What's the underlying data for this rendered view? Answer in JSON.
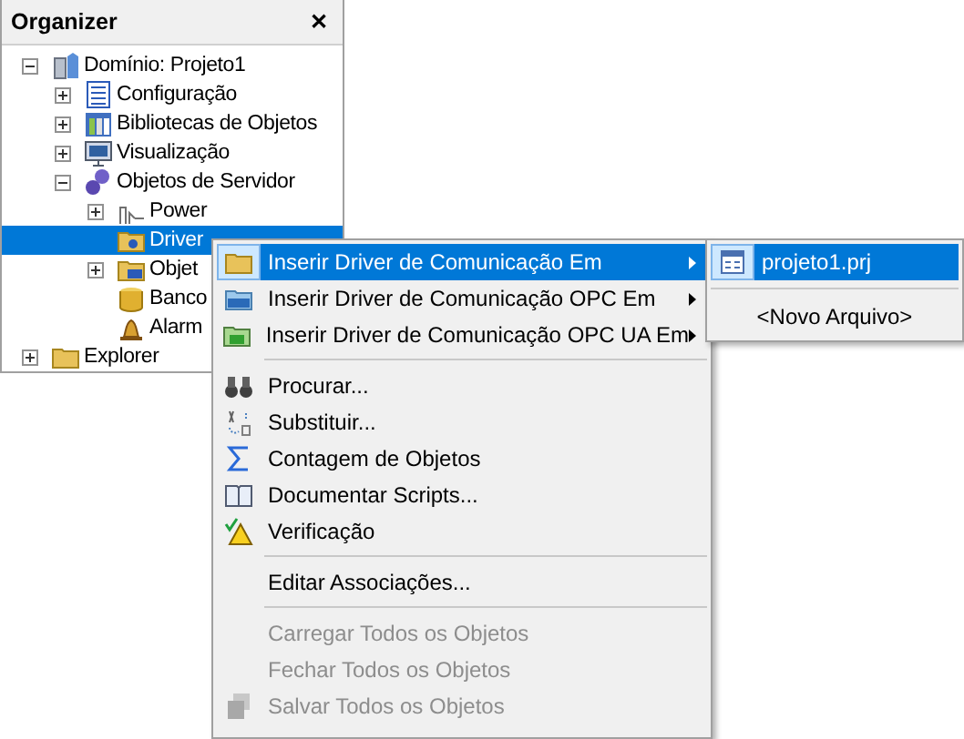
{
  "panel": {
    "title": "Organizer",
    "close": "✕"
  },
  "tree": [
    {
      "label": "Domínio: Projeto1",
      "expanded": true,
      "selected": false,
      "children": [
        {
          "label": "Configuração",
          "expanded": false,
          "selected": false
        },
        {
          "label": "Bibliotecas de Objetos",
          "expanded": false,
          "selected": false
        },
        {
          "label": "Visualização",
          "expanded": false,
          "selected": false
        },
        {
          "label": "Objetos de Servidor",
          "expanded": true,
          "selected": false,
          "children": [
            {
              "label": "Power",
              "expanded": false,
              "selected": false
            },
            {
              "label": "Driver",
              "selected": true
            },
            {
              "label": "Objet",
              "expanded": false,
              "selected": false
            },
            {
              "label": "Banco",
              "selected": false
            },
            {
              "label": "Alarm",
              "selected": false
            }
          ]
        }
      ]
    },
    {
      "label": "Explorer",
      "expanded": false,
      "selected": false
    }
  ],
  "context_menu": {
    "items": [
      {
        "kind": "submenu",
        "label": "Inserir Driver de Comunicação Em",
        "selected": true,
        "disabled": false
      },
      {
        "kind": "submenu",
        "label": "Inserir Driver de Comunicação OPC Em",
        "selected": false,
        "disabled": false
      },
      {
        "kind": "submenu",
        "label": "Inserir Driver de Comunicação OPC UA Em",
        "selected": false,
        "disabled": false
      },
      {
        "kind": "separator"
      },
      {
        "kind": "item",
        "label": "Procurar...",
        "selected": false,
        "disabled": false
      },
      {
        "kind": "item",
        "label": "Substituir...",
        "selected": false,
        "disabled": false
      },
      {
        "kind": "item",
        "label": "Contagem de Objetos",
        "selected": false,
        "disabled": false
      },
      {
        "kind": "item",
        "label": "Documentar Scripts...",
        "selected": false,
        "disabled": false
      },
      {
        "kind": "item",
        "label": "Verificação",
        "selected": false,
        "disabled": false
      },
      {
        "kind": "separator"
      },
      {
        "kind": "item",
        "label": "Editar Associações...",
        "selected": false,
        "disabled": false
      },
      {
        "kind": "separator"
      },
      {
        "kind": "item",
        "label": "Carregar Todos os Objetos",
        "selected": false,
        "disabled": true
      },
      {
        "kind": "item",
        "label": "Fechar Todos os Objetos",
        "selected": false,
        "disabled": true
      },
      {
        "kind": "item",
        "label": "Salvar Todos os Objetos",
        "selected": false,
        "disabled": true
      }
    ]
  },
  "submenu": {
    "items": [
      {
        "kind": "file",
        "label": "projeto1.prj",
        "selected": true
      },
      {
        "kind": "separator"
      },
      {
        "kind": "new",
        "label": "<Novo Arquivo>",
        "selected": false
      }
    ]
  }
}
